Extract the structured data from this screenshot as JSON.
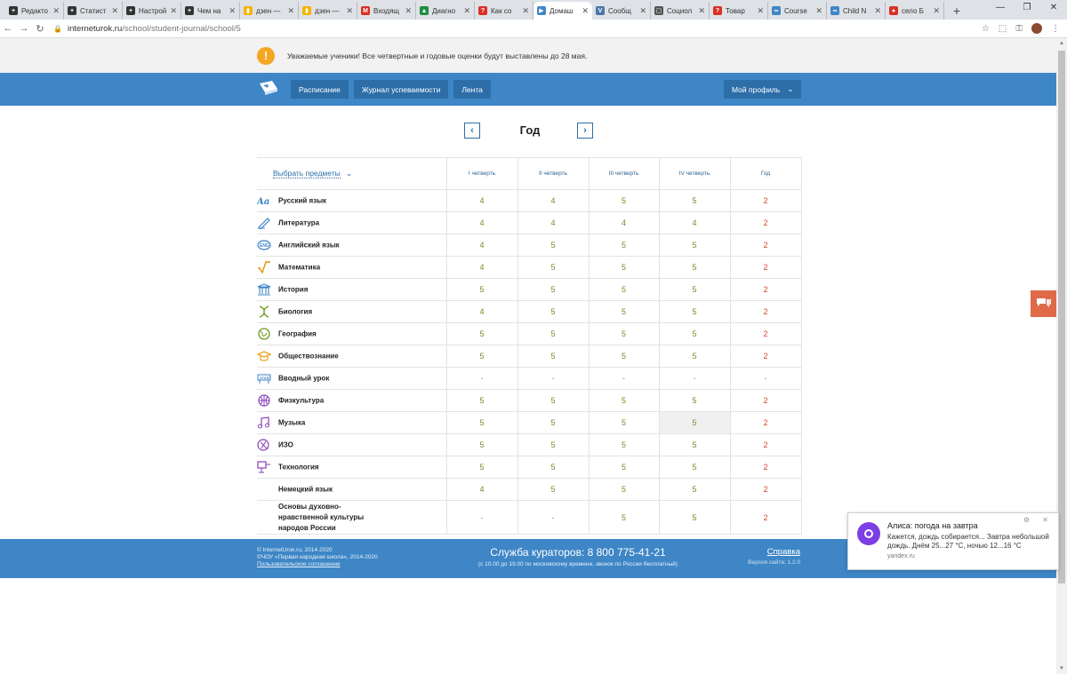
{
  "browser": {
    "tabs": [
      {
        "label": "Редакто",
        "color": "#333333",
        "glyph": "+"
      },
      {
        "label": "Статист",
        "color": "#333333",
        "glyph": "+"
      },
      {
        "label": "Настрой",
        "color": "#333333",
        "glyph": "+"
      },
      {
        "label": "Чем на",
        "color": "#333333",
        "glyph": "+"
      },
      {
        "label": "дзен —",
        "color": "#f4b400",
        "glyph": "▮"
      },
      {
        "label": "дзен —",
        "color": "#f4b400",
        "glyph": "▮"
      },
      {
        "label": "Входящ",
        "color": "#d93025",
        "glyph": "M"
      },
      {
        "label": "Диагно",
        "color": "#1e8e3e",
        "glyph": "▲"
      },
      {
        "label": "Как со",
        "color": "#d93025",
        "glyph": "?"
      },
      {
        "label": "Домаш",
        "color": "#3e86c6",
        "glyph": "▶"
      },
      {
        "label": "Сообщ",
        "color": "#4a76a8",
        "glyph": "V"
      },
      {
        "label": "Социол",
        "color": "#555555",
        "glyph": "▢"
      },
      {
        "label": "Товар",
        "color": "#d93025",
        "glyph": "?"
      },
      {
        "label": "Course",
        "color": "#3e86c6",
        "glyph": "∞"
      },
      {
        "label": "Child N",
        "color": "#3e86c6",
        "glyph": "∞"
      },
      {
        "label": "село Б",
        "color": "#d93025",
        "glyph": "●"
      }
    ],
    "active_tab_index": 9,
    "close_glyph": "✕",
    "new_tab_glyph": "+",
    "url_host": "interneturok.ru",
    "url_path": "/school/student-journal/school/5"
  },
  "notice": {
    "icon_glyph": "!",
    "text": "Уважаемые ученики! Все четвертные и годовые оценки будут выставлены до 28 мая."
  },
  "nav": {
    "links": [
      "Расписание",
      "Журнал успеваемости",
      "Лента"
    ],
    "profile_label": "Мой профиль"
  },
  "period": {
    "title": "Год",
    "prev_glyph": "‹",
    "next_glyph": "›"
  },
  "table": {
    "select_subjects_label": "Выбрать предметы",
    "columns": [
      "I четверть",
      "II четверть",
      "III четверть",
      "IV четверть",
      "Год"
    ],
    "rows": [
      {
        "subject": "Русский язык",
        "icon": "russian-icon",
        "grades": [
          "4",
          "4",
          "5",
          "5",
          "2"
        ]
      },
      {
        "subject": "Литература",
        "icon": "literature-icon",
        "grades": [
          "4",
          "4",
          "4",
          "4",
          "2"
        ]
      },
      {
        "subject": "Английский язык",
        "icon": "english-icon",
        "grades": [
          "4",
          "5",
          "5",
          "5",
          "2"
        ]
      },
      {
        "subject": "Математика",
        "icon": "math-icon",
        "grades": [
          "4",
          "5",
          "5",
          "5",
          "2"
        ]
      },
      {
        "subject": "История",
        "icon": "history-icon",
        "grades": [
          "5",
          "5",
          "5",
          "5",
          "2"
        ]
      },
      {
        "subject": "Биология",
        "icon": "biology-icon",
        "grades": [
          "4",
          "5",
          "5",
          "5",
          "2"
        ]
      },
      {
        "subject": "География",
        "icon": "geography-icon",
        "grades": [
          "5",
          "5",
          "5",
          "5",
          "2"
        ]
      },
      {
        "subject": "Обществознание",
        "icon": "social-studies-icon",
        "grades": [
          "5",
          "5",
          "5",
          "5",
          "2"
        ]
      },
      {
        "subject": "Вводный урок",
        "icon": "start-icon",
        "grades": [
          "-",
          "-",
          "-",
          "-",
          "-"
        ]
      },
      {
        "subject": "Физкультура",
        "icon": "pe-icon",
        "grades": [
          "5",
          "5",
          "5",
          "5",
          "2"
        ]
      },
      {
        "subject": "Музыка",
        "icon": "music-icon",
        "grades": [
          "5",
          "5",
          "5",
          "5",
          "2"
        ]
      },
      {
        "subject": "ИЗО",
        "icon": "art-icon",
        "grades": [
          "5",
          "5",
          "5",
          "5",
          "2"
        ]
      },
      {
        "subject": "Технология",
        "icon": "technology-icon",
        "grades": [
          "5",
          "5",
          "5",
          "5",
          "2"
        ]
      },
      {
        "subject": "Немецкий язык",
        "icon": "",
        "grades": [
          "4",
          "5",
          "5",
          "5",
          "2"
        ]
      },
      {
        "subject": "Основы духовно-нравственной культуры народов России",
        "icon": "",
        "grades": [
          "-",
          "-",
          "5",
          "5",
          "2"
        ]
      }
    ]
  },
  "footer": {
    "copyright_1": "© InternetUrok.ru, 2014-2020",
    "copyright_2": "©ЧОУ «Первая народная школа», 2014-2020",
    "agreement": "Пользовательское соглашение",
    "phone_line": "Служба кураторов: 8 800 775-41-21",
    "hours": "(с 10.00 до 19.00 по московскому времени, звонок по России бесплатный)",
    "help": "Справка",
    "version": "Версия сайта: 1.2.0"
  },
  "toast": {
    "title": "Алиса: погода на завтра",
    "body": "Кажется, дождь собирается... Завтра небольшой дождь. Днём 25...27 °C, ночью 12...16 °C",
    "source": "yandex.ru",
    "controls": "⚙ ✕"
  },
  "colors": {
    "brand_blue": "#3e86c6",
    "grade_green": "#6f8f2a",
    "grade_red": "#d2432e",
    "chat_orange": "#e0694a"
  }
}
